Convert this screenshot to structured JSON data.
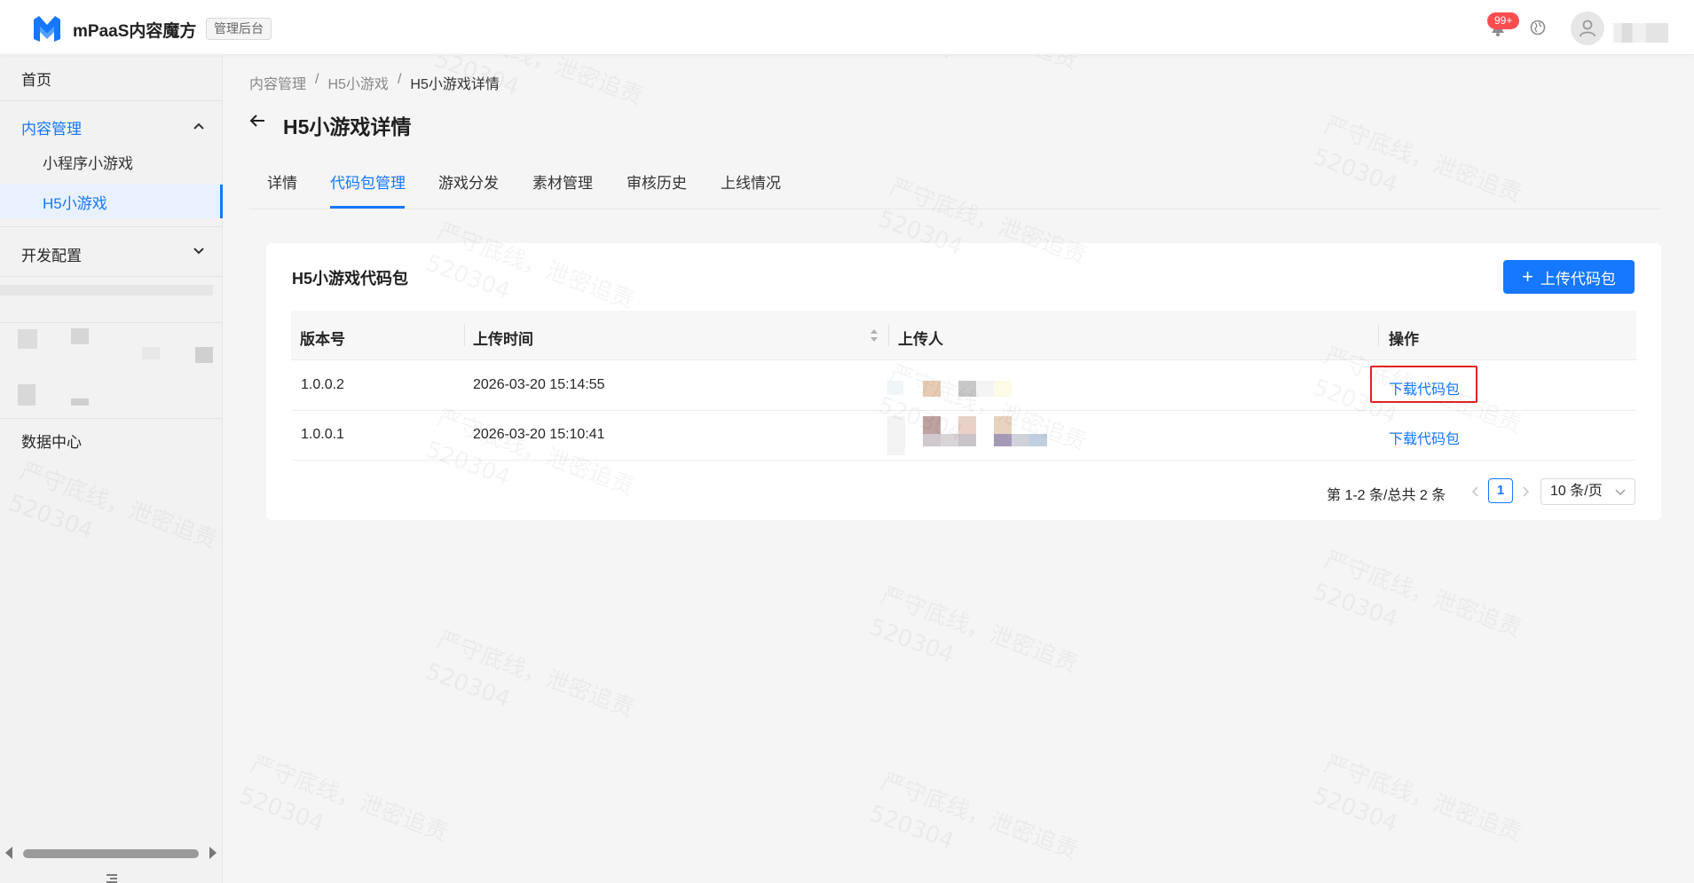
{
  "header": {
    "app_name": "mPaaS内容魔方",
    "app_tag": "管理后台",
    "notification_badge": "99+"
  },
  "sidebar": {
    "home": "首页",
    "content_group": "内容管理",
    "content_items": [
      "小程序小游戏",
      "H5小游戏"
    ],
    "dev_group": "开发配置",
    "data_center": "数据中心"
  },
  "breadcrumb": [
    "内容管理",
    "H5小游戏",
    "H5小游戏详情"
  ],
  "page_title": "H5小游戏详情",
  "tabs": [
    "详情",
    "代码包管理",
    "游戏分发",
    "素材管理",
    "审核历史",
    "上线情况"
  ],
  "active_tab": "代码包管理",
  "card": {
    "title": "H5小游戏代码包",
    "upload_label": "上传代码包"
  },
  "table": {
    "columns": [
      "版本号",
      "上传时间",
      "上传人",
      "操作"
    ],
    "rows": [
      {
        "version": "1.0.0.2",
        "upload_time": "2026-03-20 15:14:55",
        "action": "下载代码包"
      },
      {
        "version": "1.0.0.1",
        "upload_time": "2026-03-20 15:10:41",
        "action": "下载代码包"
      }
    ]
  },
  "pagination": {
    "total_text": "第 1-2 条/总共 2 条",
    "current_page": "1",
    "page_size": "10 条/页"
  },
  "watermark": {
    "text": "严守底线，泄密追责",
    "code": "520304"
  },
  "colors": {
    "primary": "#1677ff",
    "badge": "#ff4d4f",
    "highlight": "#e02424"
  }
}
